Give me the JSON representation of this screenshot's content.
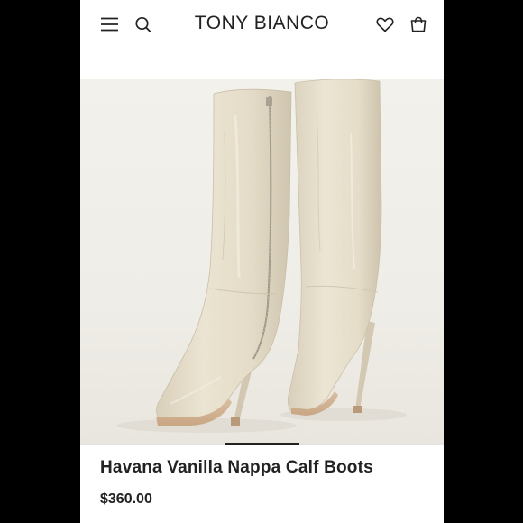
{
  "header": {
    "brand": "TONY BIANCO",
    "icons": [
      "menu-icon",
      "search-icon",
      "heart-icon",
      "shopping-bag-icon"
    ]
  },
  "product": {
    "title": "Havana Vanilla Nappa Calf Boots",
    "price": "$360.00",
    "image_alt": "Knee-high square-toe stiletto boots in vanilla cream leather"
  },
  "carousel": {
    "active_slide": 3,
    "total_slides": 5
  },
  "colors": {
    "background": "#000000",
    "page": "#ffffff",
    "text": "#222222",
    "boot_leather": "#e7dfcb",
    "photo_backdrop": "#f0eee8"
  }
}
